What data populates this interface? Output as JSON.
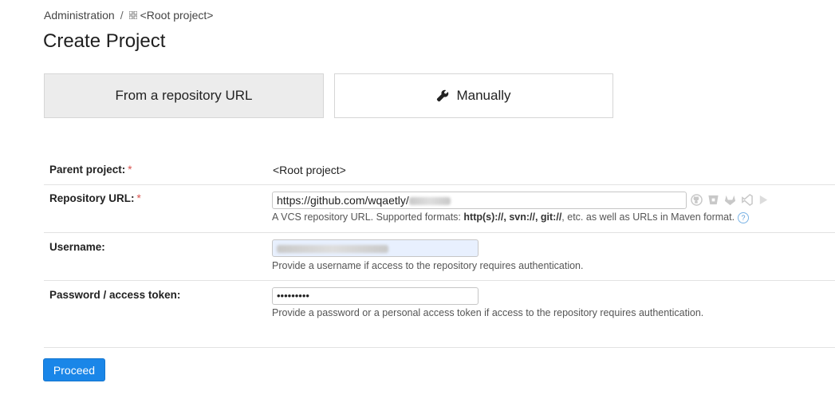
{
  "breadcrumb": {
    "root": "Administration",
    "separator": "/",
    "project": "<Root project>"
  },
  "page": {
    "title": "Create Project"
  },
  "tabs": [
    {
      "label": "From a repository URL",
      "active": true
    },
    {
      "label": "Manually",
      "active": false,
      "icon": "wrench-icon"
    }
  ],
  "form": {
    "required_mark": "*",
    "parent": {
      "label": "Parent project:",
      "value": "<Root project>"
    },
    "repo_url": {
      "label": "Repository URL:",
      "value": "https://github.com/wqaetly/",
      "note_prefix": "A VCS repository URL. Supported formats: ",
      "formats": "http(s)://, svn://, git://",
      "note_suffix": ", etc. as well as URLs in Maven format.",
      "help": "?"
    },
    "username": {
      "label": "Username:",
      "value": "",
      "note": "Provide a username if access to the repository requires authentication."
    },
    "password": {
      "label": "Password / access token:",
      "value": "•••••••••",
      "note": "Provide a password or a personal access token if access to the repository requires authentication."
    }
  },
  "vcs_icons": [
    "github-icon",
    "bitbucket-icon",
    "gitlab-icon",
    "azure-devops-icon",
    "space-icon"
  ],
  "actions": {
    "proceed": "Proceed"
  },
  "colors": {
    "primary": "#1a86e8",
    "required": "#d9534f",
    "active_tab": "#ececec"
  }
}
